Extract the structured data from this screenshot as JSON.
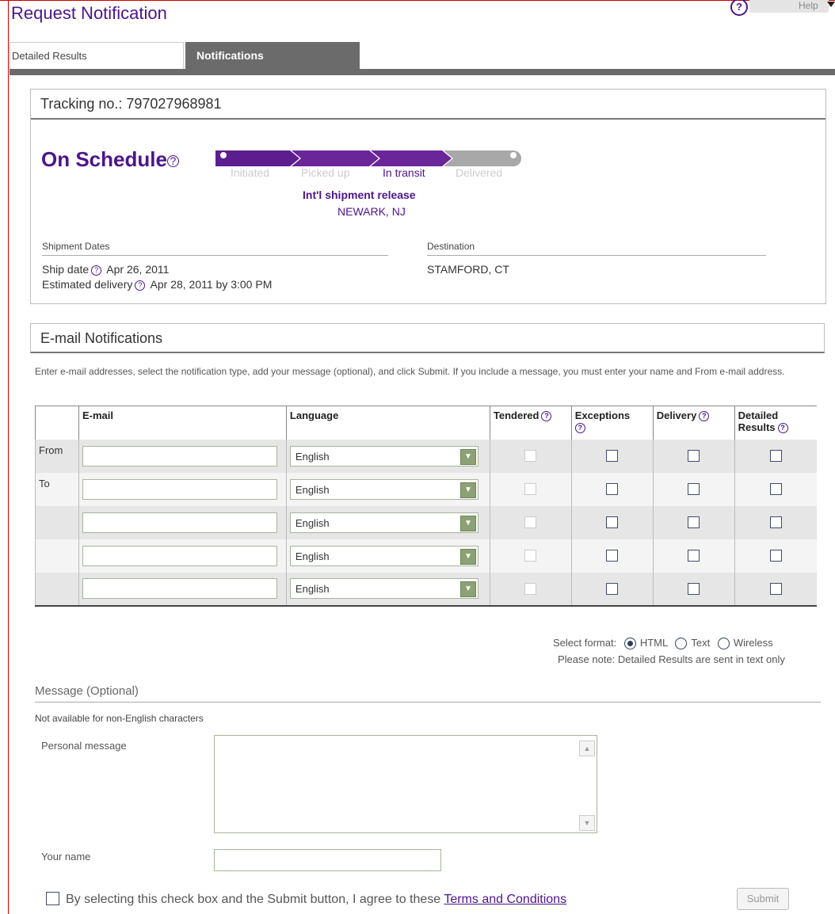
{
  "page": {
    "title": "Request Notification"
  },
  "help": {
    "label": "Help",
    "icon": "?"
  },
  "tabs": [
    {
      "label": "Detailed Results",
      "active": false
    },
    {
      "label": "Notifications",
      "active": true
    }
  ],
  "tracking": {
    "label": "Tracking no.: 797027968981"
  },
  "status": {
    "text": "On Schedule",
    "stages": [
      "Initiated",
      "Picked up",
      "In transit",
      "Delivered"
    ],
    "current_stage": "In transit",
    "event": "Int'l shipment release",
    "location": "NEWARK, NJ"
  },
  "shipment_dates": {
    "heading": "Shipment Dates",
    "ship_label": "Ship date",
    "ship_value": "Apr 26, 2011",
    "delivery_label": "Estimated delivery",
    "delivery_value": "Apr 28, 2011 by 3:00 PM"
  },
  "destination": {
    "heading": "Destination",
    "value": "STAMFORD, CT"
  },
  "email_section": {
    "title": "E-mail Notifications",
    "intro": "Enter e-mail addresses, select the notification type, add your message (optional), and click Submit. If you include a message, you must enter your name and From e-mail address.",
    "columns": [
      "E-mail",
      "Language",
      "Tendered",
      "Exceptions",
      "Delivery",
      "Detailed Results"
    ],
    "rows": [
      {
        "label": "From",
        "email": "",
        "language": "English"
      },
      {
        "label": "To",
        "email": "",
        "language": "English"
      },
      {
        "label": "",
        "email": "",
        "language": "English"
      },
      {
        "label": "",
        "email": "",
        "language": "English"
      },
      {
        "label": "",
        "email": "",
        "language": "English"
      }
    ],
    "format_label": "Select format:",
    "formats": [
      "HTML",
      "Text",
      "Wireless"
    ],
    "selected_format": "HTML",
    "format_note": "Please note: Detailed Results are sent in text only"
  },
  "message": {
    "title": "Message (Optional)",
    "note": "Not available for non-English characters",
    "personal_label": "Personal message",
    "name_label": "Your name"
  },
  "agree": {
    "text": "By selecting this check box and the Submit button, I agree to these ",
    "link": "Terms and Conditions"
  },
  "submit_label": "Submit"
}
